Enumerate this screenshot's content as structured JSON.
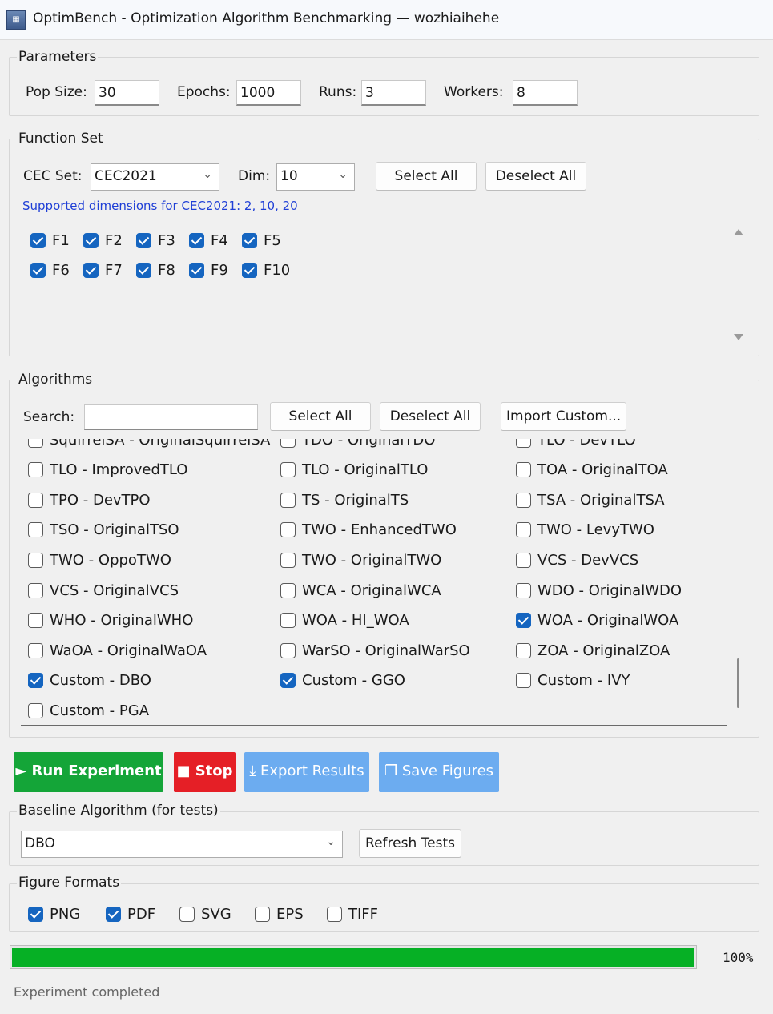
{
  "window": {
    "title": "OptimBench - Optimization Algorithm Benchmarking  —  wozhiaihehe"
  },
  "parameters": {
    "title": "Parameters",
    "pop_size": {
      "label": "Pop Size:",
      "value": "30"
    },
    "epochs": {
      "label": "Epochs:",
      "value": "1000"
    },
    "runs": {
      "label": "Runs:",
      "value": "3"
    },
    "workers": {
      "label": "Workers:",
      "value": "8"
    }
  },
  "function_set": {
    "title": "Function Set",
    "cec_label": "CEC Set:",
    "cec_value": "CEC2021",
    "dim_label": "Dim:",
    "dim_value": "10",
    "select_all": "Select All",
    "deselect_all": "Deselect All",
    "hint": "Supported dimensions for CEC2021: 2, 10, 20",
    "functions": [
      {
        "label": "F1",
        "checked": true
      },
      {
        "label": "F2",
        "checked": true
      },
      {
        "label": "F3",
        "checked": true
      },
      {
        "label": "F4",
        "checked": true
      },
      {
        "label": "F5",
        "checked": true
      },
      {
        "label": "F6",
        "checked": true
      },
      {
        "label": "F7",
        "checked": true
      },
      {
        "label": "F8",
        "checked": true
      },
      {
        "label": "F9",
        "checked": true
      },
      {
        "label": "F10",
        "checked": true
      }
    ]
  },
  "algorithms": {
    "title": "Algorithms",
    "search_label": "Search:",
    "search_value": "",
    "select_all": "Select All",
    "deselect_all": "Deselect All",
    "import_custom": "Import Custom...",
    "items": [
      {
        "label": "SquirrelSA - OriginalSquirrelSA",
        "checked": false
      },
      {
        "label": "TDO - OriginalTDO",
        "checked": false
      },
      {
        "label": "TLO - DevTLO",
        "checked": false
      },
      {
        "label": "TLO - ImprovedTLO",
        "checked": false
      },
      {
        "label": "TLO - OriginalTLO",
        "checked": false
      },
      {
        "label": "TOA - OriginalTOA",
        "checked": false
      },
      {
        "label": "TPO - DevTPO",
        "checked": false
      },
      {
        "label": "TS - OriginalTS",
        "checked": false
      },
      {
        "label": "TSA - OriginalTSA",
        "checked": false
      },
      {
        "label": "TSO - OriginalTSO",
        "checked": false
      },
      {
        "label": "TWO - EnhancedTWO",
        "checked": false
      },
      {
        "label": "TWO - LevyTWO",
        "checked": false
      },
      {
        "label": "TWO - OppoTWO",
        "checked": false
      },
      {
        "label": "TWO - OriginalTWO",
        "checked": false
      },
      {
        "label": "VCS - DevVCS",
        "checked": false
      },
      {
        "label": "VCS - OriginalVCS",
        "checked": false
      },
      {
        "label": "WCA - OriginalWCA",
        "checked": false
      },
      {
        "label": "WDO - OriginalWDO",
        "checked": false
      },
      {
        "label": "WHO - OriginalWHO",
        "checked": false
      },
      {
        "label": "WOA - HI_WOA",
        "checked": false
      },
      {
        "label": "WOA - OriginalWOA",
        "checked": true
      },
      {
        "label": "WaOA - OriginalWaOA",
        "checked": false
      },
      {
        "label": "WarSO - OriginalWarSO",
        "checked": false
      },
      {
        "label": "ZOA - OriginalZOA",
        "checked": false
      },
      {
        "label": "Custom - DBO",
        "checked": true
      },
      {
        "label": "Custom - GGO",
        "checked": true
      },
      {
        "label": "Custom - IVY",
        "checked": false
      },
      {
        "label": "Custom - PGA",
        "checked": false
      }
    ]
  },
  "actions": {
    "run": {
      "icon": "play-icon",
      "label": "Run Experiment",
      "color": "#14a538"
    },
    "stop": {
      "icon": "stop-icon",
      "label": "Stop",
      "color": "#e51f26"
    },
    "export": {
      "icon": "download-icon",
      "label": "Export Results",
      "color": "#6cacf0"
    },
    "save": {
      "icon": "copy-icon",
      "label": "Save Figures",
      "color": "#6cacf0"
    }
  },
  "baseline": {
    "title": "Baseline Algorithm (for tests)",
    "value": "DBO",
    "refresh": "Refresh Tests"
  },
  "figure_formats": {
    "title": "Figure Formats",
    "formats": [
      {
        "label": "PNG",
        "checked": true
      },
      {
        "label": "PDF",
        "checked": true
      },
      {
        "label": "SVG",
        "checked": false
      },
      {
        "label": "EPS",
        "checked": false
      },
      {
        "label": "TIFF",
        "checked": false
      }
    ]
  },
  "progress": {
    "value": 1.0,
    "text": "100%"
  },
  "status": "Experiment completed"
}
